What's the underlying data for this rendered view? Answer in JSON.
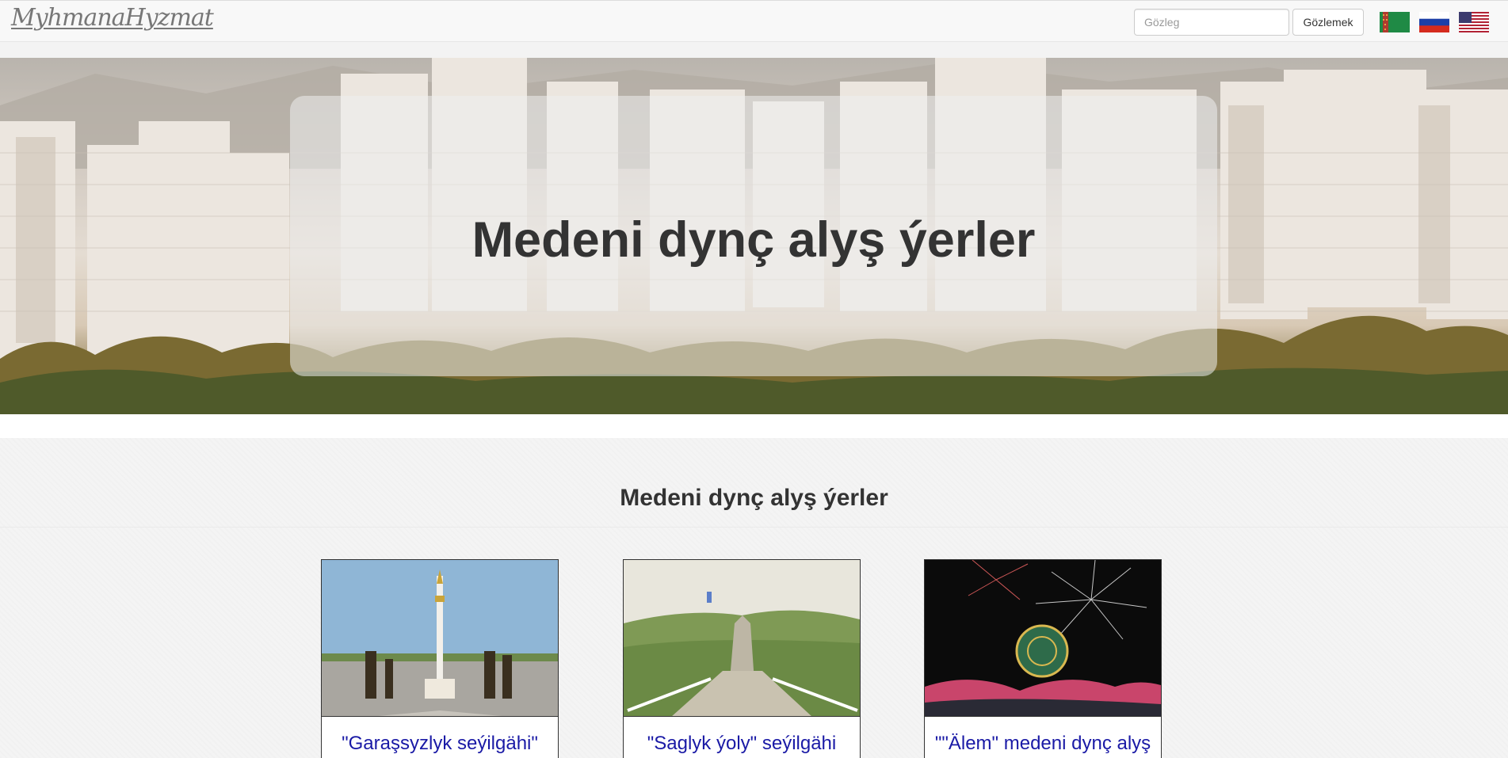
{
  "navbar": {
    "brand": "MyhmanaHyzmat",
    "search_placeholder": "Gözleg",
    "search_button": "Gözlemek",
    "languages": [
      {
        "name": "turkmen-flag-icon"
      },
      {
        "name": "russian-flag-icon"
      },
      {
        "name": "us-flag-icon"
      }
    ]
  },
  "hero": {
    "title": "Medeni dynç alyş ýerler"
  },
  "section": {
    "title": "Medeni dynç alyş ýerler",
    "cards": [
      {
        "title": "\"Garaşsyzlyk seýilgähi\"",
        "image": "independence-park-photo"
      },
      {
        "title": "\"Saglyk ýoly\" seýilgähi",
        "image": "health-path-photo"
      },
      {
        "title": "\"\"Älem\" medeni dynç alyş",
        "image": "alem-fireworks-photo"
      }
    ]
  },
  "colors": {
    "link": "#1a1aa6",
    "navbar_bg": "#f8f8f8"
  }
}
